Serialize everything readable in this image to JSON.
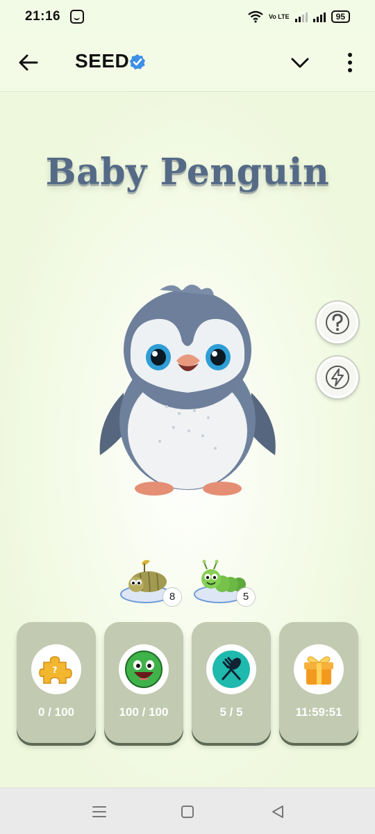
{
  "status_bar": {
    "time": "21:16",
    "network": "Vo LTE",
    "battery": "95",
    "icons": [
      "app-notification-icon",
      "wifi-icon",
      "signal-icon",
      "battery-icon"
    ]
  },
  "header": {
    "title": "SEED",
    "icons": [
      "back-arrow-icon",
      "verified-badge-icon",
      "chevron-down-icon",
      "more-vertical-icon"
    ]
  },
  "pet": {
    "name": "Baby Penguin",
    "image": "baby-penguin-icon"
  },
  "side_actions": [
    {
      "icon": "question-icon"
    },
    {
      "icon": "lightning-icon"
    }
  ],
  "foods": [
    {
      "icon": "beetle-food-icon",
      "count": "8"
    },
    {
      "icon": "caterpillar-food-icon",
      "count": "5"
    }
  ],
  "cards": [
    {
      "icon": "puzzle-icon",
      "value": "0 / 100"
    },
    {
      "icon": "happy-face-icon",
      "value": "100 / 100"
    },
    {
      "icon": "fork-spoon-icon",
      "value": "5 / 5"
    },
    {
      "icon": "gift-box-icon",
      "value": "11:59:51"
    }
  ],
  "colors": {
    "background": "#eef8dc",
    "title": "#546a86",
    "card": "#c2cab1",
    "card_shadow": "#5f6a55",
    "verified": "#3d8ee8",
    "teal": "#1fb9ad",
    "green": "#3fb24a"
  },
  "nav": [
    "menu-icon",
    "home-icon",
    "back-triangle-icon"
  ]
}
